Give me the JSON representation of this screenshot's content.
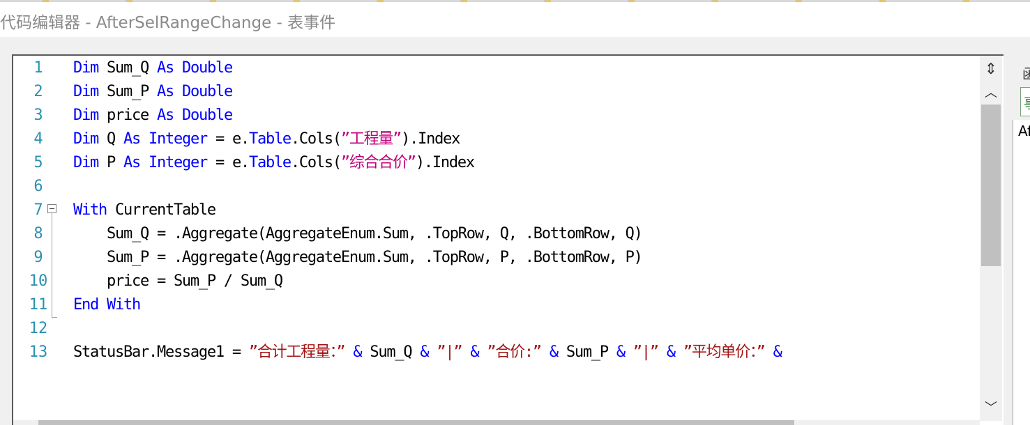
{
  "window": {
    "title": "代码编辑器 - AfterSelRangeChange - 表事件"
  },
  "editor": {
    "lines": [
      {
        "number": "1",
        "tokens": [
          {
            "t": "Dim",
            "c": "kw"
          },
          {
            "t": " Sum_Q ",
            "c": ""
          },
          {
            "t": "As",
            "c": "kw"
          },
          {
            "t": " ",
            "c": ""
          },
          {
            "t": "Double",
            "c": "kw"
          }
        ]
      },
      {
        "number": "2",
        "tokens": [
          {
            "t": "Dim",
            "c": "kw"
          },
          {
            "t": " Sum_P ",
            "c": ""
          },
          {
            "t": "As",
            "c": "kw"
          },
          {
            "t": " ",
            "c": ""
          },
          {
            "t": "Double",
            "c": "kw"
          }
        ]
      },
      {
        "number": "3",
        "tokens": [
          {
            "t": "Dim",
            "c": "kw"
          },
          {
            "t": " price ",
            "c": ""
          },
          {
            "t": "As",
            "c": "kw"
          },
          {
            "t": " ",
            "c": ""
          },
          {
            "t": "Double",
            "c": "kw"
          }
        ]
      },
      {
        "number": "4",
        "tokens": [
          {
            "t": "Dim",
            "c": "kw"
          },
          {
            "t": " Q ",
            "c": ""
          },
          {
            "t": "As",
            "c": "kw"
          },
          {
            "t": " ",
            "c": ""
          },
          {
            "t": "Integer",
            "c": "kw"
          },
          {
            "t": " = e.",
            "c": ""
          },
          {
            "t": "Table",
            "c": "kw"
          },
          {
            "t": ".Cols(",
            "c": ""
          },
          {
            "t": "”工程量”",
            "c": "cn"
          },
          {
            "t": ").Index",
            "c": ""
          }
        ]
      },
      {
        "number": "5",
        "tokens": [
          {
            "t": "Dim",
            "c": "kw"
          },
          {
            "t": " P ",
            "c": ""
          },
          {
            "t": "As",
            "c": "kw"
          },
          {
            "t": " ",
            "c": ""
          },
          {
            "t": "Integer",
            "c": "kw"
          },
          {
            "t": " = e.",
            "c": ""
          },
          {
            "t": "Table",
            "c": "kw"
          },
          {
            "t": ".Cols(",
            "c": ""
          },
          {
            "t": "”综合合价”",
            "c": "cn"
          },
          {
            "t": ").Index",
            "c": ""
          }
        ]
      },
      {
        "number": "6",
        "tokens": []
      },
      {
        "number": "7",
        "tokens": [
          {
            "t": "With",
            "c": "kw"
          },
          {
            "t": " CurrentTable",
            "c": ""
          }
        ]
      },
      {
        "number": "8",
        "tokens": [
          {
            "t": "    Sum_Q = .Aggregate(AggregateEnum.Sum, .TopRow, Q, .BottomRow, Q)",
            "c": ""
          }
        ]
      },
      {
        "number": "9",
        "tokens": [
          {
            "t": "    Sum_P = .Aggregate(AggregateEnum.Sum, .TopRow, P, .BottomRow, P)",
            "c": ""
          }
        ]
      },
      {
        "number": "10",
        "tokens": [
          {
            "t": "    price = Sum_P / Sum_Q",
            "c": ""
          }
        ]
      },
      {
        "number": "11",
        "tokens": [
          {
            "t": "End",
            "c": "kw"
          },
          {
            "t": " ",
            "c": ""
          },
          {
            "t": "With",
            "c": "kw"
          }
        ]
      },
      {
        "number": "12",
        "tokens": []
      },
      {
        "number": "13",
        "tokens": [
          {
            "t": "StatusBar.Message1 = ",
            "c": ""
          },
          {
            "t": "”合计工程量：”",
            "c": "str"
          },
          {
            "t": " ",
            "c": ""
          },
          {
            "t": "&",
            "c": "kw"
          },
          {
            "t": " Sum_Q ",
            "c": ""
          },
          {
            "t": "&",
            "c": "kw"
          },
          {
            "t": " ",
            "c": ""
          },
          {
            "t": "”|”",
            "c": "str"
          },
          {
            "t": " ",
            "c": ""
          },
          {
            "t": "&",
            "c": "kw"
          },
          {
            "t": " ",
            "c": ""
          },
          {
            "t": "”合价:”",
            "c": "str"
          },
          {
            "t": " ",
            "c": ""
          },
          {
            "t": "&",
            "c": "kw"
          },
          {
            "t": " Sum_P ",
            "c": ""
          },
          {
            "t": "&",
            "c": "kw"
          },
          {
            "t": " ",
            "c": ""
          },
          {
            "t": "”|”",
            "c": "str"
          },
          {
            "t": " ",
            "c": ""
          },
          {
            "t": "&",
            "c": "kw"
          },
          {
            "t": " ",
            "c": ""
          },
          {
            "t": "”平均单价：”",
            "c": "str"
          },
          {
            "t": " ",
            "c": ""
          },
          {
            "t": "&",
            "c": "kw"
          }
        ]
      }
    ]
  },
  "scrollbar": {
    "split_icon": "split-view-icon",
    "up_icon": "chevron-up-icon",
    "down_icon": "chevron-down-icon",
    "up_glyph": "︿",
    "down_glyph": "﹀",
    "split_glyph": "⇕"
  },
  "right_panel": {
    "label": "函",
    "tab_label": "事",
    "list_item": "Af"
  },
  "colors": {
    "keyword": "#0000ff",
    "string": "#a31515",
    "cn_string": "#c0007a",
    "line_number": "#2b91af"
  }
}
